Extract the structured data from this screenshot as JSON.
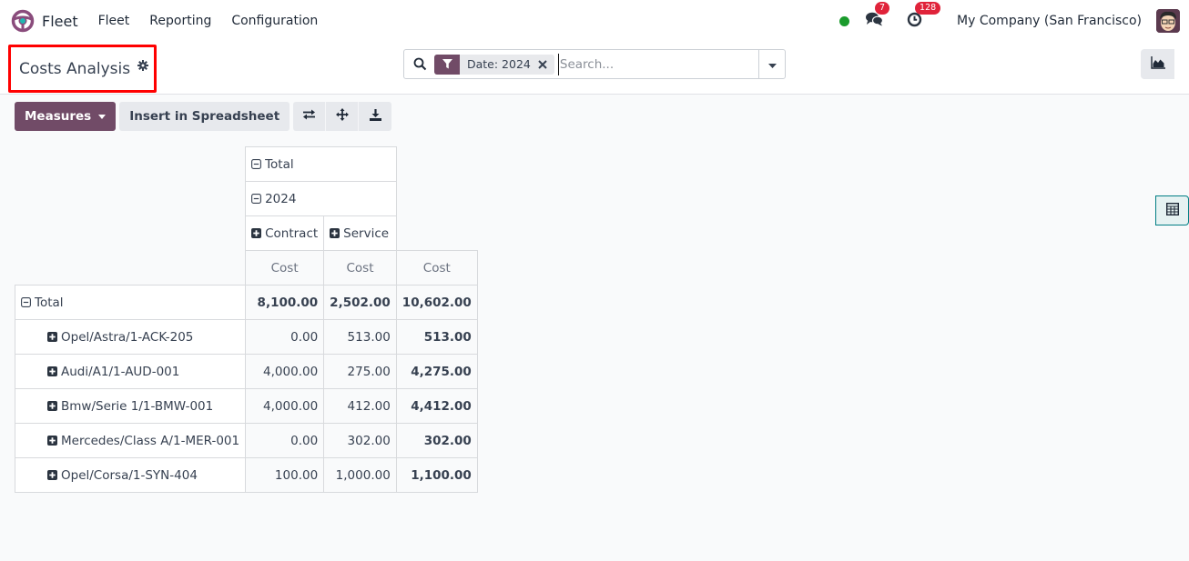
{
  "navbar": {
    "app_name": "Fleet",
    "menu": [
      "Fleet",
      "Reporting",
      "Configuration"
    ],
    "messages_count": "7",
    "activities_count": "128",
    "company": "My Company (San Francisco)"
  },
  "control_panel": {
    "title": "Costs Analysis",
    "search": {
      "facet_label": "Date: 2024",
      "placeholder": "Search..."
    },
    "views": [
      "graph",
      "pivot"
    ],
    "active_view": "pivot"
  },
  "toolbar": {
    "measures_label": "Measures",
    "insert_label": "Insert in Spreadsheet"
  },
  "pivot": {
    "col_total_label": "Total",
    "col_year_label": "2024",
    "col_groups": [
      "Contract",
      "Service"
    ],
    "measure_label": "Cost",
    "row_total": {
      "label": "Total",
      "values": [
        "8,100.00",
        "2,502.00",
        "10,602.00"
      ]
    },
    "rows": [
      {
        "label": "Opel/Astra/1-ACK-205",
        "values": [
          "0.00",
          "513.00",
          "513.00"
        ]
      },
      {
        "label": "Audi/A1/1-AUD-001",
        "values": [
          "4,000.00",
          "275.00",
          "4,275.00"
        ]
      },
      {
        "label": "Bmw/Serie 1/1-BMW-001",
        "values": [
          "4,000.00",
          "412.00",
          "4,412.00"
        ]
      },
      {
        "label": "Mercedes/Class A/1-MER-001",
        "values": [
          "0.00",
          "302.00",
          "302.00"
        ]
      },
      {
        "label": "Opel/Corsa/1-SYN-404",
        "values": [
          "100.00",
          "1,000.00",
          "1,100.00"
        ]
      }
    ]
  }
}
